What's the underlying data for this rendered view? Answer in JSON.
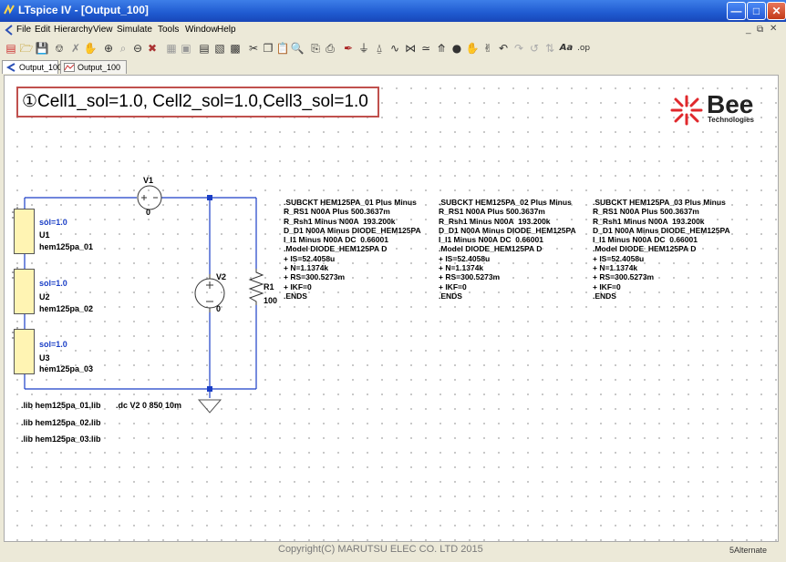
{
  "window": {
    "title": "LTspice IV - [Output_100]"
  },
  "menu": [
    "File",
    "Edit",
    "Hierarchy",
    "View",
    "Simulate",
    "Tools",
    "Window",
    "Help"
  ],
  "tabs": [
    "Output_100",
    "Output_100"
  ],
  "annotation": "①Cell1_sol=1.0, Cell2_sol=1.0,Cell3_sol=1.0",
  "logo": {
    "text": "Bee",
    "subtext": "Technologies",
    "color": "#e0282c"
  },
  "schematic": {
    "v1": {
      "name": "V1",
      "value": "0"
    },
    "v2": {
      "name": "V2",
      "value": "0"
    },
    "r1": {
      "name": "R1",
      "value": "100"
    },
    "cells": [
      {
        "param": "sol=1.0",
        "ref": "U1",
        "model": "hem125pa_01"
      },
      {
        "param": "sol=1.0",
        "ref": "U2",
        "model": "hem125pa_02"
      },
      {
        "param": "sol=1.0",
        "ref": "U3",
        "model": "hem125pa_03"
      }
    ],
    "directives": [
      ".lib hem125pa_01.lib",
      ".lib hem125pa_02.lib",
      ".lib hem125pa_03.lib"
    ],
    "dc_directive": ".dc V2 0 850 10m",
    "netlists": [
      ".SUBCKT HEM125PA_01 Plus Minus\nR_RS1 N00A Plus 500.3637m\nR_Rsh1 Minus N00A  193.200k\nD_D1 N00A Minus DIODE_HEM125PA\nI_I1 Minus N00A DC  0.66001\n.Model DIODE_HEM125PA D\n+ IS=52.4058u\n+ N=1.1374k\n+ RS=300.5273m\n+ IKF=0\n.ENDS",
      ".SUBCKT HEM125PA_02 Plus Minus\nR_RS1 N00A Plus 500.3637m\nR_Rsh1 Minus N00A  193.200k\nD_D1 N00A Minus DIODE_HEM125PA\nI_I1 Minus N00A DC  0.66001\n.Model DIODE_HEM125PA D\n+ IS=52.4058u\n+ N=1.1374k\n+ RS=300.5273m\n+ IKF=0\n.ENDS",
      ".SUBCKT HEM125PA_03 Plus Minus\nR_RS1 N00A Plus 500.3637m\nR_Rsh1 Minus N00A  193.200k\nD_D1 N00A Minus DIODE_HEM125PA\nI_I1 Minus N00A DC  0.66001\n.Model DIODE_HEM125PA D\n+ IS=52.4058u\n+ N=1.1374k\n+ RS=300.5273m\n+ IKF=0\n.ENDS"
    ]
  },
  "status": {
    "copyright": "Copyright(C) MARUTSU ELEC CO. LTD 2015",
    "page": "5",
    "mode": "Alternate"
  }
}
